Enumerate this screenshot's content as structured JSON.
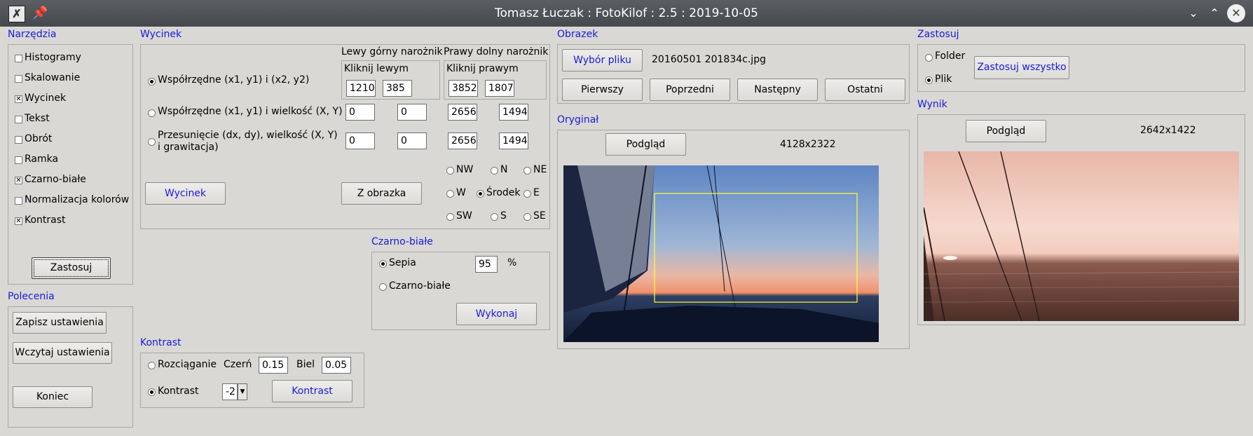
{
  "window": {
    "title": "Tomasz Łuczak : FotoKilof : 2.5 : 2019-10-05",
    "minimize_glyph": "⌄",
    "maximize_glyph": "⌃",
    "close_glyph": "✕"
  },
  "narzedzia": {
    "title": "Narzędzia",
    "items": [
      {
        "label": "Histogramy",
        "checked": false
      },
      {
        "label": "Skalowanie",
        "checked": false
      },
      {
        "label": "Wycinek",
        "checked": true
      },
      {
        "label": "Tekst",
        "checked": false
      },
      {
        "label": "Obrót",
        "checked": false
      },
      {
        "label": "Ramka",
        "checked": false
      },
      {
        "label": "Czarno-białe",
        "checked": true
      },
      {
        "label": "Normalizacja kolorów",
        "checked": false
      },
      {
        "label": "Kontrast",
        "checked": true
      }
    ],
    "apply_label": "Zastosuj"
  },
  "polecenia": {
    "title": "Polecenia",
    "save_label": "Zapisz ustawienia",
    "load_label": "Wczytaj ustawienia",
    "end_label": "Koniec"
  },
  "wycinek": {
    "title": "Wycinek",
    "top_left_header": "Lewy górny narożnik",
    "bottom_right_header": "Prawy dolny narożnik",
    "click_left": "Kliknij lewym",
    "click_right": "Kliknij prawym",
    "opt1": "Współrzędne (x1, y1) i (x2, y2)",
    "opt2": "Współrzędne (x1, y1) i wielkość (X, Y)",
    "opt3_line1": "Przesunięcie (dx, dy), wielkość (X, Y)",
    "opt3_line2": "i grawitacja)",
    "row1": [
      "1210",
      "385",
      "3852",
      "1807"
    ],
    "row2": [
      "0",
      "0",
      "2656",
      "1494"
    ],
    "row3": [
      "0",
      "0",
      "2656",
      "1494"
    ],
    "gravity": {
      "nw": "NW",
      "n": "N",
      "ne": "NE",
      "w": "W",
      "center": "Środek",
      "e": "E",
      "sw": "SW",
      "s": "S",
      "se": "SE"
    },
    "crop_button": "Wycinek",
    "from_image_button": "Z obrazka"
  },
  "czarnobiale": {
    "title": "Czarno-białe",
    "sepia_label": "Sepia",
    "sepia_value": "95",
    "percent": "%",
    "bw_label": "Czarno-białe",
    "run_label": "Wykonaj"
  },
  "kontrast": {
    "title": "Kontrast",
    "stretch_label": "Rozciąganie",
    "black_label": "Czerń",
    "black_value": "0.15",
    "white_label": "Biel",
    "white_value": "0.05",
    "contrast_label": "Kontrast",
    "contrast_value": "-2",
    "button_label": "Kontrast"
  },
  "obrazek": {
    "title": "Obrazek",
    "choose_file": "Wybór pliku",
    "filename": "20160501 201834c.jpg",
    "first": "Pierwszy",
    "prev": "Poprzedni",
    "next": "Następny",
    "last": "Ostatni"
  },
  "oryginal": {
    "title": "Oryginał",
    "preview": "Podgląd",
    "size": "4128x2322"
  },
  "zastosuj": {
    "title": "Zastosuj",
    "folder": "Folder",
    "plik": "Plik",
    "apply_all": "Zastosuj wszystko"
  },
  "wynik": {
    "title": "Wynik",
    "preview": "Podgląd",
    "size": "2642x1422"
  },
  "colors": {
    "group_title": "#1a1adb",
    "selection": "#ffff33"
  }
}
